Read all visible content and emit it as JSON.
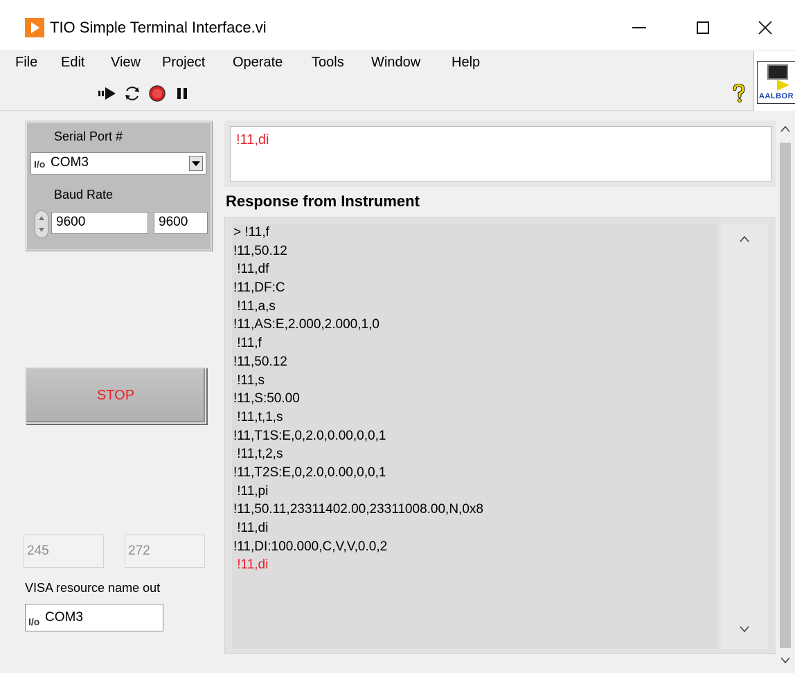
{
  "window": {
    "title": "TIO Simple Terminal Interface.vi",
    "controls": {
      "minimize": "minimize",
      "maximize": "maximize",
      "close": "close"
    }
  },
  "menu": {
    "items": [
      "File",
      "Edit",
      "View",
      "Project",
      "Operate",
      "Tools",
      "Window",
      "Help"
    ]
  },
  "toolbar": {
    "buttons": [
      {
        "name": "run",
        "icon": "run-arrow-icon"
      },
      {
        "name": "run-continuously",
        "icon": "run-continuously-icon"
      },
      {
        "name": "abort",
        "icon": "abort-stop-icon"
      },
      {
        "name": "pause",
        "icon": "pause-icon"
      }
    ],
    "help_icon": "help-question-icon",
    "vi_icon_label": "AALBOR"
  },
  "serial": {
    "port_label": "Serial Port #",
    "port_value": "COM3",
    "baud_label": "Baud Rate",
    "baud_value": "9600",
    "baud_indicator": "9600"
  },
  "stop_button": {
    "label": "STOP"
  },
  "indicators": {
    "left_value": "245",
    "right_value": "272"
  },
  "visa": {
    "label": "VISA resource name out",
    "value": "COM3"
  },
  "command": {
    "value": "!11,di"
  },
  "response": {
    "label": "Response from Instrument",
    "lines": [
      "> !11,f",
      "!11,50.12",
      " !11,df",
      "!11,DF:C",
      " !11,a,s",
      "!11,AS:E,2.000,2.000,1,0",
      " !11,f",
      "!11,50.12",
      " !11,s",
      "!11,S:50.00",
      " !11,t,1,s",
      "!11,T1S:E,0,2.0,0.00,0,0,1",
      " !11,t,2,s",
      "!11,T2S:E,0,2.0,0.00,0,0,1",
      " !11,pi",
      "!11,50.11,23311402.00,23311008.00,N,0x8",
      " !11,di",
      "!11,DI:100.000,C,V,V,0.0,2",
      " !11,di"
    ]
  },
  "colors": {
    "accent_red": "#e8202a",
    "logo_orange": "#f5841f"
  }
}
